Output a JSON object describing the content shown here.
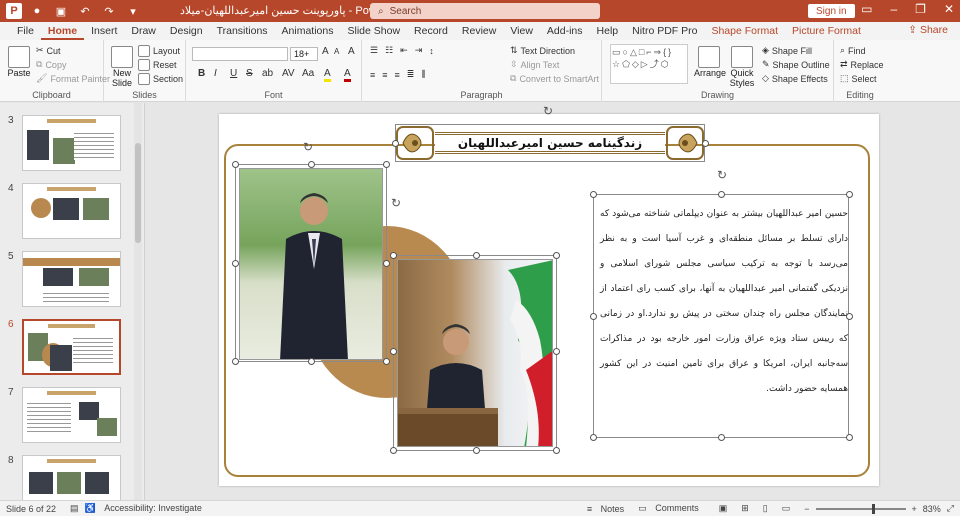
{
  "titlebar": {
    "doc_title": "پاورپوینت حسین امیرعبداللهیان-میلاد  -  PowerPoint",
    "search_placeholder": "Search",
    "signin": "Sign in",
    "logo": "P"
  },
  "menu": {
    "tabs": [
      "File",
      "Home",
      "Insert",
      "Draw",
      "Design",
      "Transitions",
      "Animations",
      "Slide Show",
      "Record",
      "Review",
      "View",
      "Add-ins",
      "Help",
      "Nitro PDF Pro"
    ],
    "context_tabs": [
      "Shape Format",
      "Picture Format"
    ],
    "active": "Home",
    "share": "Share"
  },
  "ribbon": {
    "clipboard": {
      "label": "Clipboard",
      "paste": "Paste",
      "cut": "Cut",
      "copy": "Copy",
      "format_painter": "Format Painter"
    },
    "slides": {
      "label": "Slides",
      "new_slide": "New Slide",
      "layout": "Layout",
      "reset": "Reset",
      "section": "Section"
    },
    "font": {
      "label": "Font",
      "font_name": "",
      "font_size": "18+",
      "bold": "B",
      "italic": "I",
      "underline": "U",
      "strike": "S",
      "shadow": "ab",
      "spacing": "AV",
      "case": "Aa",
      "grow": "A",
      "shrink": "A",
      "highlight": "A",
      "color": "A",
      "clear": "A"
    },
    "paragraph": {
      "label": "Paragraph",
      "text_direction": "Text Direction",
      "align_text": "Align Text",
      "smartart": "Convert to SmartArt"
    },
    "drawing": {
      "label": "Drawing",
      "arrange": "Arrange",
      "quick_styles": "Quick Styles",
      "shape_fill": "Shape Fill",
      "shape_outline": "Shape Outline",
      "shape_effects": "Shape Effects"
    },
    "editing": {
      "label": "Editing",
      "find": "Find",
      "replace": "Replace",
      "select": "Select"
    }
  },
  "thumbnails": [
    {
      "num": "3",
      "active": false
    },
    {
      "num": "4",
      "active": false
    },
    {
      "num": "5",
      "active": false
    },
    {
      "num": "6",
      "active": true
    },
    {
      "num": "7",
      "active": false
    },
    {
      "num": "8",
      "active": false
    }
  ],
  "slide": {
    "title": "زندگینامه حسین امیرعبداللهیان",
    "body": "حسین امیر عبداللهیان بیشتر به عنوان دیپلماتی شناخته می‌شود که دارای تسلط بر مسائل منطقه‌ای و غرب آسیا است و به نظر می‌رسد با توجه به ترکیب سیاسی مجلس شورای اسلامی و نزدیکی گفتمانی امیر عبداللهیان به آنها، برای کسب رای اعتماد از نمایندگان مجلس راه چندان سختی در پیش رو ندارد.او در زمانی که رییس ستاد ویژه عراق وزارت امور خارجه بود در مذاکرات سه‌جانبه ایران، امریکا و عراق برای تامین امنیت در این کشور همسایه حضور داشت."
  },
  "status": {
    "slide_info": "Slide 6 of 22",
    "accessibility": "Accessibility: Investigate",
    "notes": "Notes",
    "comments": "Comments",
    "zoom": "83%"
  },
  "colors": {
    "accent": "#b7472a",
    "gold": "#a8823a",
    "circle": "#b98a50"
  }
}
